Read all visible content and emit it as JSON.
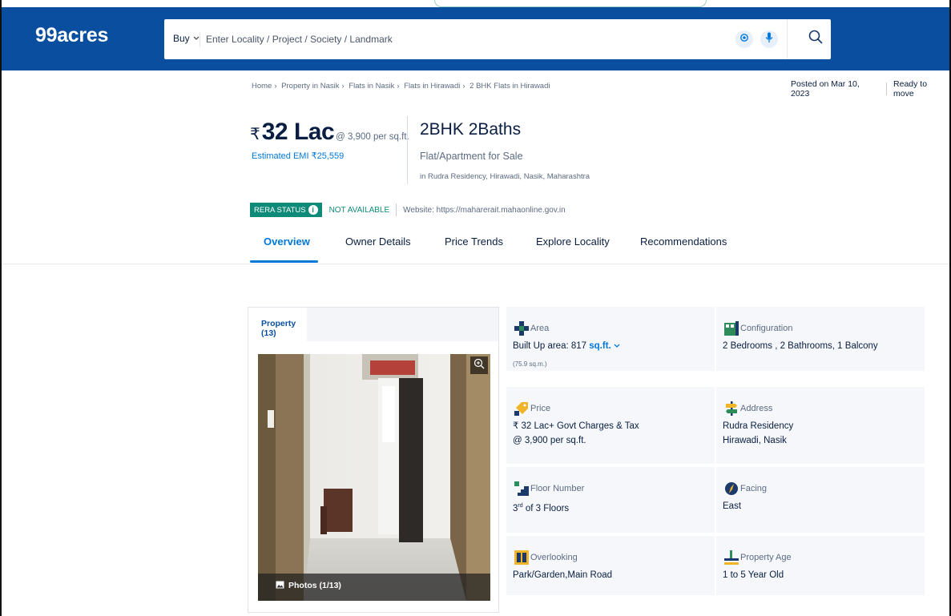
{
  "header": {
    "logo": "99acres",
    "buy_label": "Buy",
    "search_placeholder": "Enter Locality / Project / Society / Landmark"
  },
  "breadcrumb": [
    "Home",
    "Property in Nasik",
    "Flats in Nasik",
    "Flats in Hirawadi",
    "2 BHK Flats in Hirawadi"
  ],
  "posted": {
    "date": "Posted on Mar 10, 2023",
    "status": "Ready to move"
  },
  "price": {
    "rupee": "₹",
    "amount": "32 Lac",
    "per_sqft": "@ 3,900 per sq.ft.",
    "emi": "Estimated EMI ₹25,559"
  },
  "title": {
    "config": "2BHK 2Baths",
    "type": "Flat/Apartment for Sale",
    "location": "in Rudra Residency, Hirawadi, Nasik, Maharashtra"
  },
  "rera": {
    "badge": "RERA STATUS",
    "status": "NOT AVAILABLE",
    "website": "Website: https://maharerait.mahaonline.gov.in"
  },
  "tabs": [
    "Overview",
    "Owner Details",
    "Price Trends",
    "Explore Locality",
    "Recommendations"
  ],
  "gallery": {
    "tab_label": "Property (13)",
    "photos_label": "Photos (1/13)"
  },
  "details": {
    "area": {
      "label": "Area",
      "value": "Built Up area: 817",
      "unit": "sq.ft.",
      "sub": "(75.9 sq.m.)"
    },
    "configuration": {
      "label": "Configuration",
      "value": "2 Bedrooms , 2 Bathrooms, 1 Balcony"
    },
    "price": {
      "label": "Price",
      "value": "₹ 32 Lac+ Govt Charges & Tax",
      "value2": "@ 3,900 per sq.ft."
    },
    "address": {
      "label": "Address",
      "value": "Rudra Residency",
      "value2": "Hirawadi, Nasik"
    },
    "floor": {
      "label": "Floor Number",
      "value_num": "3",
      "value_sup": "rd",
      "value_rest": " of 3 Floors"
    },
    "facing": {
      "label": "Facing",
      "value": "East"
    },
    "overlooking": {
      "label": "Overlooking",
      "value": "Park/Garden,Main Road"
    },
    "age": {
      "label": "Property Age",
      "value": "1 to 5 Year Old"
    }
  },
  "colors": {
    "brand_blue": "#0a4f9f",
    "link_blue": "#0078db",
    "rera_green": "#0e8a78"
  }
}
